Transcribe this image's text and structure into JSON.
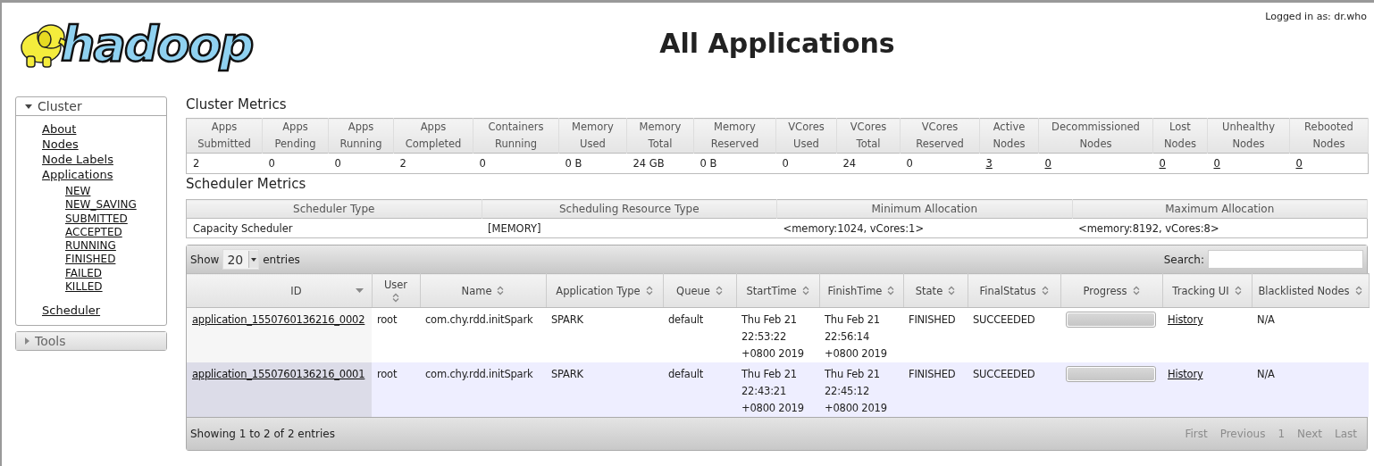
{
  "header": {
    "logo_text": "hadoop",
    "title": "All Applications",
    "login": "Logged in as: dr.who"
  },
  "sidebar": [
    {
      "label": "Cluster",
      "expanded": true,
      "items": [
        {
          "label": "About"
        },
        {
          "label": "Nodes"
        },
        {
          "label": "Node Labels"
        },
        {
          "label": "Applications",
          "children": [
            {
              "label": "NEW"
            },
            {
              "label": "NEW_SAVING"
            },
            {
              "label": "SUBMITTED"
            },
            {
              "label": "ACCEPTED"
            },
            {
              "label": "RUNNING"
            },
            {
              "label": "FINISHED"
            },
            {
              "label": "FAILED"
            },
            {
              "label": "KILLED"
            }
          ]
        },
        {
          "label": "Scheduler"
        }
      ]
    },
    {
      "label": "Tools",
      "expanded": false
    }
  ],
  "cluster_metrics": {
    "title": "Cluster Metrics",
    "columns": [
      {
        "label": [
          "Apps",
          "Submitted"
        ],
        "value": "2",
        "link": false
      },
      {
        "label": [
          "Apps",
          "Pending"
        ],
        "value": "0",
        "link": false
      },
      {
        "label": [
          "Apps",
          "Running"
        ],
        "value": "0",
        "link": false
      },
      {
        "label": [
          "Apps",
          "Completed"
        ],
        "value": "2",
        "link": false
      },
      {
        "label": [
          "Containers",
          "Running"
        ],
        "value": "0",
        "link": false
      },
      {
        "label": [
          "Memory",
          "Used"
        ],
        "value": "0 B",
        "link": false
      },
      {
        "label": [
          "Memory",
          "Total"
        ],
        "value": "24 GB",
        "link": false
      },
      {
        "label": [
          "Memory",
          "Reserved"
        ],
        "value": "0 B",
        "link": false
      },
      {
        "label": [
          "VCores",
          "Used"
        ],
        "value": "0",
        "link": false
      },
      {
        "label": [
          "VCores",
          "Total"
        ],
        "value": "24",
        "link": false
      },
      {
        "label": [
          "VCores",
          "Reserved"
        ],
        "value": "0",
        "link": false
      },
      {
        "label": [
          "Active",
          "Nodes"
        ],
        "value": "3",
        "link": true
      },
      {
        "label": [
          "Decommissioned",
          "Nodes"
        ],
        "value": "0",
        "link": true
      },
      {
        "label": [
          "Lost",
          "Nodes"
        ],
        "value": "0",
        "link": true
      },
      {
        "label": [
          "Unhealthy",
          "Nodes"
        ],
        "value": "0",
        "link": true
      },
      {
        "label": [
          "Rebooted",
          "Nodes"
        ],
        "value": "0",
        "link": true
      }
    ]
  },
  "scheduler_metrics": {
    "title": "Scheduler Metrics",
    "columns": [
      "Scheduler Type",
      "Scheduling Resource Type",
      "Minimum Allocation",
      "Maximum Allocation"
    ],
    "row": [
      "Capacity Scheduler",
      "[MEMORY]",
      "<memory:1024, vCores:1>",
      "<memory:8192, vCores:8>"
    ]
  },
  "applications": {
    "show_label": "Show",
    "page_size": "20",
    "entries_label": "entries",
    "search_label": "Search:",
    "columns": [
      {
        "label": "ID",
        "sorted": true
      },
      {
        "label": "User",
        "sorted": false
      },
      {
        "label": "Name",
        "sorted": false
      },
      {
        "label": "Application Type",
        "sorted": false
      },
      {
        "label": "Queue",
        "sorted": false
      },
      {
        "label": "StartTime",
        "sorted": false
      },
      {
        "label": "FinishTime",
        "sorted": false
      },
      {
        "label": "State",
        "sorted": false
      },
      {
        "label": "FinalStatus",
        "sorted": false
      },
      {
        "label": "Progress",
        "sorted": false
      },
      {
        "label": "Tracking UI",
        "sorted": false
      },
      {
        "label": "Blacklisted Nodes",
        "sorted": false
      }
    ],
    "rows": [
      {
        "id": "application_1550760136216_0002",
        "user": "root",
        "name": "com.chy.rdd.initSpark",
        "type": "SPARK",
        "queue": "default",
        "start": [
          "Thu Feb 21",
          "22:53:22",
          "+0800 2019"
        ],
        "finish": [
          "Thu Feb 21",
          "22:56:14",
          "+0800 2019"
        ],
        "state": "FINISHED",
        "final_status": "SUCCEEDED",
        "progress": {
          "level": 1
        },
        "tracking": "History",
        "blacklisted": "N/A"
      },
      {
        "id": "application_1550760136216_0001",
        "user": "root",
        "name": "com.chy.rdd.initSpark",
        "type": "SPARK",
        "queue": "default",
        "start": [
          "Thu Feb 21",
          "22:43:21",
          "+0800 2019"
        ],
        "finish": [
          "Thu Feb 21",
          "22:45:12",
          "+0800 2019"
        ],
        "state": "FINISHED",
        "final_status": "SUCCEEDED",
        "progress": {
          "level": 1
        },
        "tracking": "History",
        "blacklisted": "N/A"
      }
    ],
    "info": "Showing 1 to 2 of 2 entries",
    "pagination": [
      {
        "label": "First",
        "disabled": true
      },
      {
        "label": "Previous",
        "disabled": true
      },
      {
        "label": "1",
        "disabled": true
      },
      {
        "label": "Next",
        "disabled": true
      },
      {
        "label": "Last",
        "disabled": true
      }
    ]
  }
}
